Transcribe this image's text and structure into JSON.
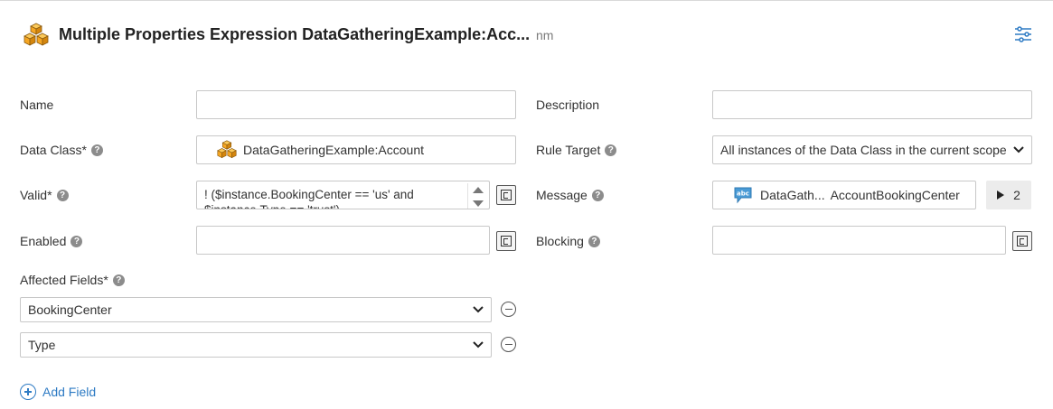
{
  "header": {
    "title": "Multiple Properties Expression DataGatheringExample:Acc...",
    "unit": "nm"
  },
  "form": {
    "name": {
      "label": "Name",
      "value": ""
    },
    "description": {
      "label": "Description",
      "value": ""
    },
    "data_class": {
      "label": "Data Class*",
      "help": "?",
      "value": "DataGatheringExample:Account"
    },
    "rule_target": {
      "label": "Rule Target",
      "help": "?",
      "value": "All instances of the Data Class in the current scope"
    },
    "valid": {
      "label": "Valid*",
      "help": "?",
      "value": "! ($instance.BookingCenter == 'us' and\n$instance.Type == 'trust')"
    },
    "message": {
      "label": "Message",
      "help": "?",
      "value_prefix": "DataGath...",
      "value": "AccountBookingCenter",
      "count": "2"
    },
    "enabled": {
      "label": "Enabled",
      "help": "?",
      "value": ""
    },
    "blocking": {
      "label": "Blocking",
      "help": "?",
      "value": ""
    },
    "affected_fields": {
      "label": "Affected Fields*",
      "help": "?",
      "items": [
        "BookingCenter",
        "Type"
      ]
    },
    "add_field_label": "Add Field"
  },
  "colors": {
    "accent": "#2e7bc4",
    "cube": "#f5a623",
    "message_icon": "#4a9bd6"
  },
  "icons": {
    "header": "cube-stack-icon",
    "settings": "sliders-icon",
    "data_class": "cube-stack-icon",
    "message": "abc-speech-bubble-icon"
  }
}
